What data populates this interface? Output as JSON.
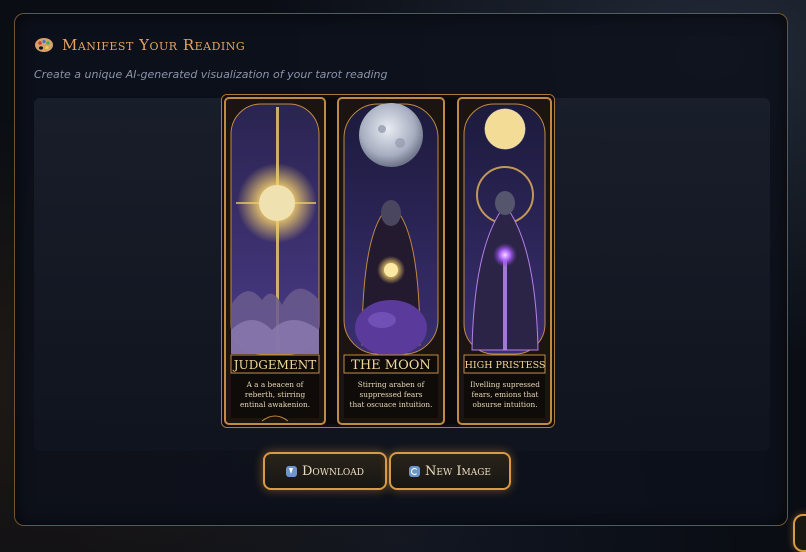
{
  "panel": {
    "title": "Manifest Your Reading",
    "icon": "palette-icon",
    "subtitle": "Create a unique AI-generated visualization of your tarot reading"
  },
  "cards": [
    {
      "title": "JUDGEMENT",
      "lines": [
        "A  a a beacen of",
        "reberth, stirring",
        "entinal awakenion."
      ]
    },
    {
      "title": "THE MOON",
      "lines": [
        "Stirring araben of",
        "suppressed fears",
        "that oscuace intuition."
      ]
    },
    {
      "title": "HIGH PRISTESS",
      "lines": [
        "Ilvelling supressed",
        "fears, emions that",
        "obsurse intuition."
      ]
    }
  ],
  "actions": {
    "download_label": "Download",
    "download_icon": "download-icon",
    "new_image_label": "New Image",
    "new_image_icon": "refresh-icon"
  },
  "colors": {
    "accent": "#e7a35b",
    "border": "#d99a45",
    "background": "#0a0d14"
  }
}
